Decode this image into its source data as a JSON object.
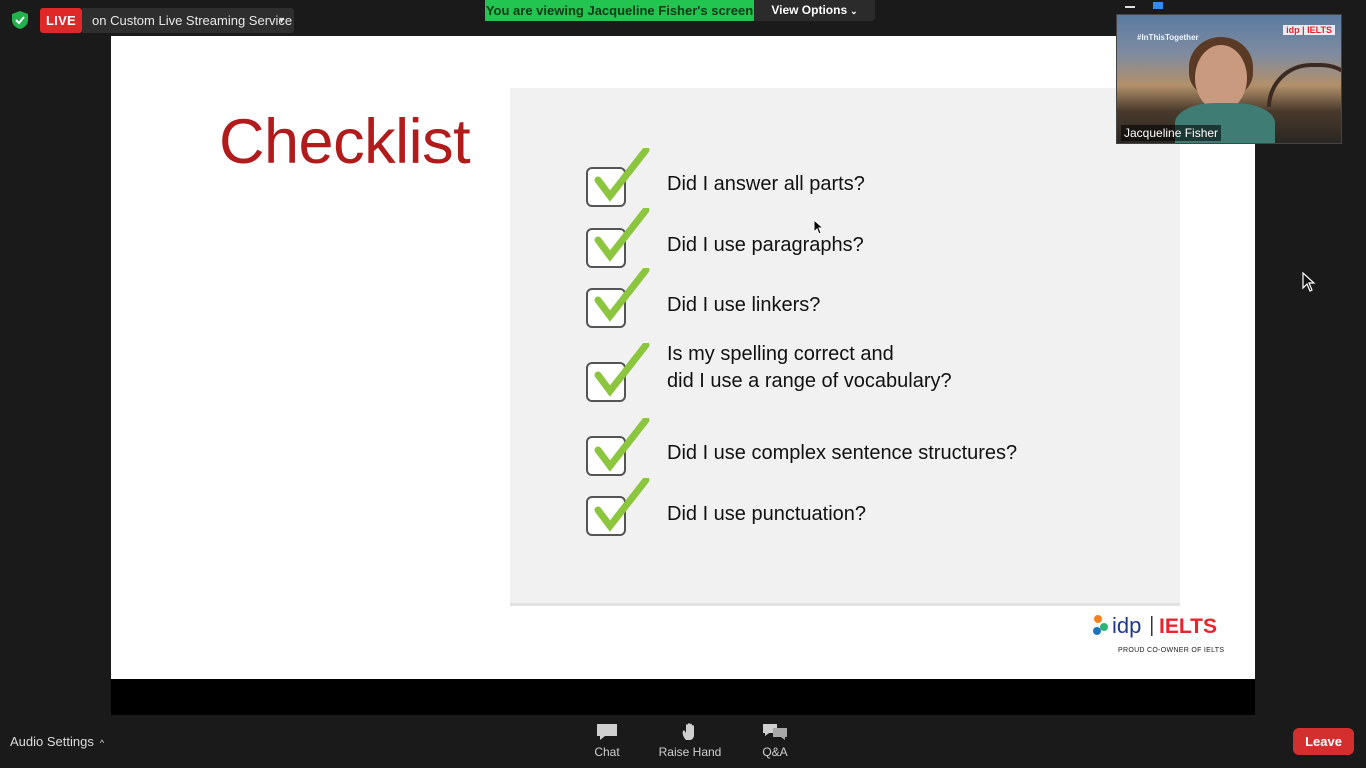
{
  "meeting_bar": {
    "live_label": "LIVE",
    "stream_target": "on Custom Live Streaming Service",
    "viewing_banner": "You are viewing Jacqueline Fisher's screen",
    "view_options_label": "View Options"
  },
  "slide": {
    "title": "Checklist",
    "items": [
      {
        "text": "Did I answer all parts?"
      },
      {
        "text": "Did I use paragraphs?"
      },
      {
        "text": "Did I use linkers?"
      },
      {
        "text": "Is my spelling correct and",
        "text2": "did I use a range of vocabulary?"
      },
      {
        "text": "Did I use complex sentence structures?"
      },
      {
        "text": "Did I use punctuation?"
      }
    ],
    "brand_logo": "idp | IELTS",
    "brand_tagline": "PROUD CO-OWNER OF IELTS"
  },
  "video": {
    "participant_name": "Jacqueline Fisher",
    "hashtag": "#InThisTogether",
    "brand": "idp | IELTS"
  },
  "controls": {
    "audio_settings_label": "Audio Settings",
    "chat_label": "Chat",
    "raise_hand_label": "Raise Hand",
    "qa_label": "Q&A",
    "leave_label": "Leave"
  },
  "colors": {
    "live_red": "#e02828",
    "banner_green": "#23c551",
    "title_red": "#b11b1b",
    "check_green": "#8cc63f",
    "leave_red": "#d32f2f",
    "ielts_red": "#e8252a"
  }
}
